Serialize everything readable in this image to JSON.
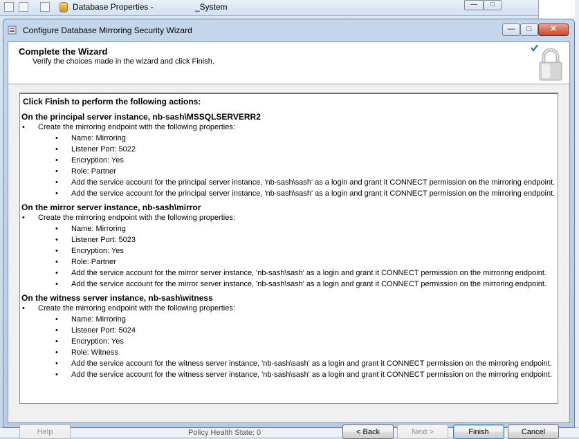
{
  "background_window": {
    "title": "Database Properties - ",
    "title_suffix": "_System",
    "bottom_text": "Policy Health State:    0",
    "controls": {
      "minimize": "—",
      "maximize": "□"
    }
  },
  "wizard": {
    "title": "Configure Database Mirroring Security Wizard",
    "controls": {
      "minimize": "—",
      "maximize": "□",
      "close": "✕"
    },
    "header": {
      "heading": "Complete the Wizard",
      "subheading": "Verify the choices made in the wizard and click Finish."
    },
    "summary": {
      "title": "Click Finish to perform the following actions:",
      "sections": [
        {
          "heading": "On the principal server instance, nb-sash\\MSSQLSERVERR2",
          "action": "Create the mirroring endpoint with the following properties:",
          "items": [
            "Name: Mirroring",
            "Listener Port: 5022",
            "Encryption: Yes",
            "Role: Partner",
            "Add the service account for the principal server instance, 'nb-sash\\sash' as a login and grant it CONNECT permission on the mirroring endpoint.",
            "Add the service account for the principal server instance, 'nb-sash\\sash' as a login and grant it CONNECT permission on the mirroring endpoint."
          ]
        },
        {
          "heading": "On the mirror server instance, nb-sash\\mirror",
          "action": "Create the mirroring endpoint with the following properties:",
          "items": [
            "Name: Mirroring",
            "Listener Port: 5023",
            "Encryption: Yes",
            "Role: Partner",
            "Add the service account for the mirror server instance, 'nb-sash\\sash' as a login and grant it CONNECT permission on the mirroring endpoint.",
            "Add the service account for the mirror server instance, 'nb-sash\\sash' as a login and grant it CONNECT permission on the mirroring endpoint."
          ]
        },
        {
          "heading": "On the witness server instance, nb-sash\\witness",
          "action": "Create the mirroring endpoint with the following properties:",
          "items": [
            "Name: Mirroring",
            "Listener Port: 5024",
            "Encryption: Yes",
            "Role: Witness",
            "Add the service account for the witness server instance, 'nb-sash\\sash' as a login and grant it CONNECT permission on the mirroring endpoint.",
            "Add the service account for the witness server instance, 'nb-sash\\sash' as a login and grant it CONNECT permission on the mirroring endpoint."
          ]
        }
      ]
    },
    "buttons": {
      "help": "Help",
      "back": "< Back",
      "next": "Next >",
      "finish": "Finish",
      "cancel": "Cancel"
    }
  },
  "colors": {
    "titlebar": "#c4d6ec",
    "dialog_background": "#f0f0f0",
    "default_button_border": "#3c7fb1",
    "checkmark": "#2a6fb8"
  }
}
